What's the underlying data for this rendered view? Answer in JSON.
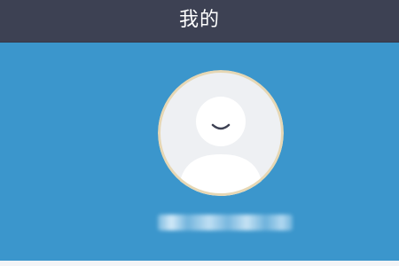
{
  "header": {
    "title": "我的"
  },
  "profile": {
    "avatar_icon": "default-user-avatar-icon"
  },
  "colors": {
    "header_bg": "#3d4153",
    "panel_bg": "#3b96cc",
    "avatar_bg": "#eef0f3",
    "avatar_silhouette": "#ffffff",
    "avatar_ring": "#e6d7b4"
  }
}
